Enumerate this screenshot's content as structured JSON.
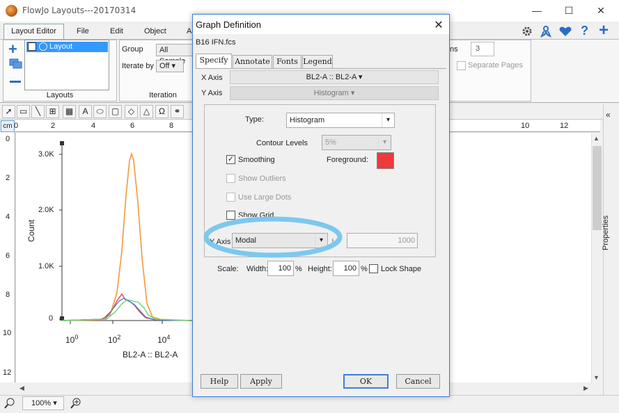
{
  "window": {
    "title": "FlowJo Layouts---20170314",
    "min": "—",
    "max": "☐",
    "close": "✕"
  },
  "ribbon": {
    "tabs": [
      "Layout Editor",
      "File",
      "Edit",
      "Object",
      "A"
    ],
    "layouts_list": [
      "Layout"
    ],
    "layouts_group_label": "Layouts",
    "iteration_group_label": "Iteration",
    "group_label": "Group",
    "group_value": "All Sample",
    "iterate_by_label": "Iterate by",
    "iterate_by_value": "Off",
    "columns_label": "ns",
    "columns_value": "3",
    "separate_pages": "Separate Pages"
  },
  "toolbar": {
    "tools": [
      "pointer-tool",
      "rectangle-tool",
      "line-tool",
      "table-tool",
      "grid-tool",
      "text-tool",
      "ellipse-tool",
      "rounded-rect-tool",
      "diamond-tool",
      "triangle-tool",
      "omega-tool",
      "link-tool"
    ]
  },
  "ruler": {
    "unit": "cm",
    "top": [
      "0",
      "2",
      "4",
      "6",
      "8",
      "10",
      "12"
    ],
    "left": [
      "0",
      "2",
      "4",
      "6",
      "8",
      "10",
      "12"
    ]
  },
  "graph": {
    "y_ticks": [
      "3.0K",
      "2.0K",
      "1.0K",
      "0"
    ],
    "y_label": "Count",
    "x_tick_bases": [
      "10",
      "10",
      "10"
    ],
    "x_tick_exps": [
      "0",
      "2",
      "4"
    ],
    "x_label": "BL2-A :: BL2-A",
    "colors": {
      "orange": "#f2993a",
      "red": "#e8454a",
      "blue": "#4a7fd6",
      "green": "#6fd36b"
    }
  },
  "statusbar": {
    "zoom": "100%"
  },
  "side_panel": {
    "label": "Properties"
  },
  "dialog": {
    "title": "Graph Definition",
    "file": "B16 IFN.fcs",
    "tabs": [
      "Specify",
      "Annotate",
      "Fonts",
      "Legend"
    ],
    "x_axis_label": "X Axis",
    "x_axis_value": "BL2-A :: BL2-A",
    "y_axis_label": "Y Axis",
    "y_axis_value": "Histogram",
    "type_label": "Type:",
    "type_value": "Histogram",
    "contour_label": "Contour Levels",
    "contour_value": "5%",
    "smoothing": "Smoothing",
    "foreground_label": "Foreground:",
    "foreground_color": "#ee3a3a",
    "show_outliers": "Show Outliers",
    "use_large_dots": "Use Large Dots",
    "show_grid": "Show Grid",
    "y_axis_mode_label": "Y Axis",
    "y_axis_mode_value": "Modal",
    "max_label": "M",
    "max_value": "1000",
    "scale_label": "Scale:",
    "width_label": "Width:",
    "width_value": "100",
    "height_label": "Height:",
    "height_value": "100",
    "percent": "%",
    "lock_shape": "Lock Shape",
    "help": "Help",
    "apply": "Apply",
    "ok": "OK",
    "cancel": "Cancel",
    "highlight_color": "#7cc8ee"
  }
}
